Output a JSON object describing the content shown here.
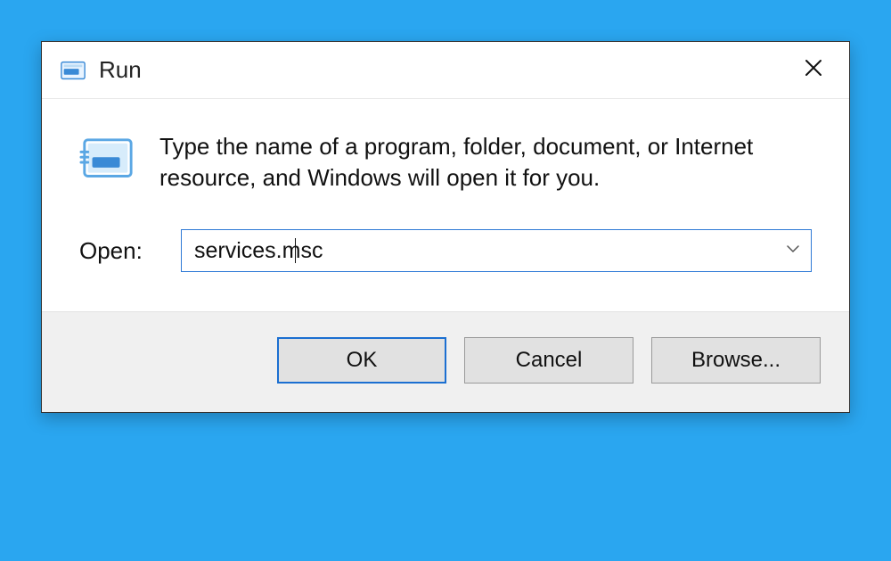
{
  "dialog": {
    "title": "Run",
    "description": "Type the name of a program, folder, document, or Internet resource, and Windows will open it for you.",
    "open_label": "Open:",
    "command_value": "services.msc",
    "buttons": {
      "ok": "OK",
      "cancel": "Cancel",
      "browse": "Browse..."
    }
  }
}
